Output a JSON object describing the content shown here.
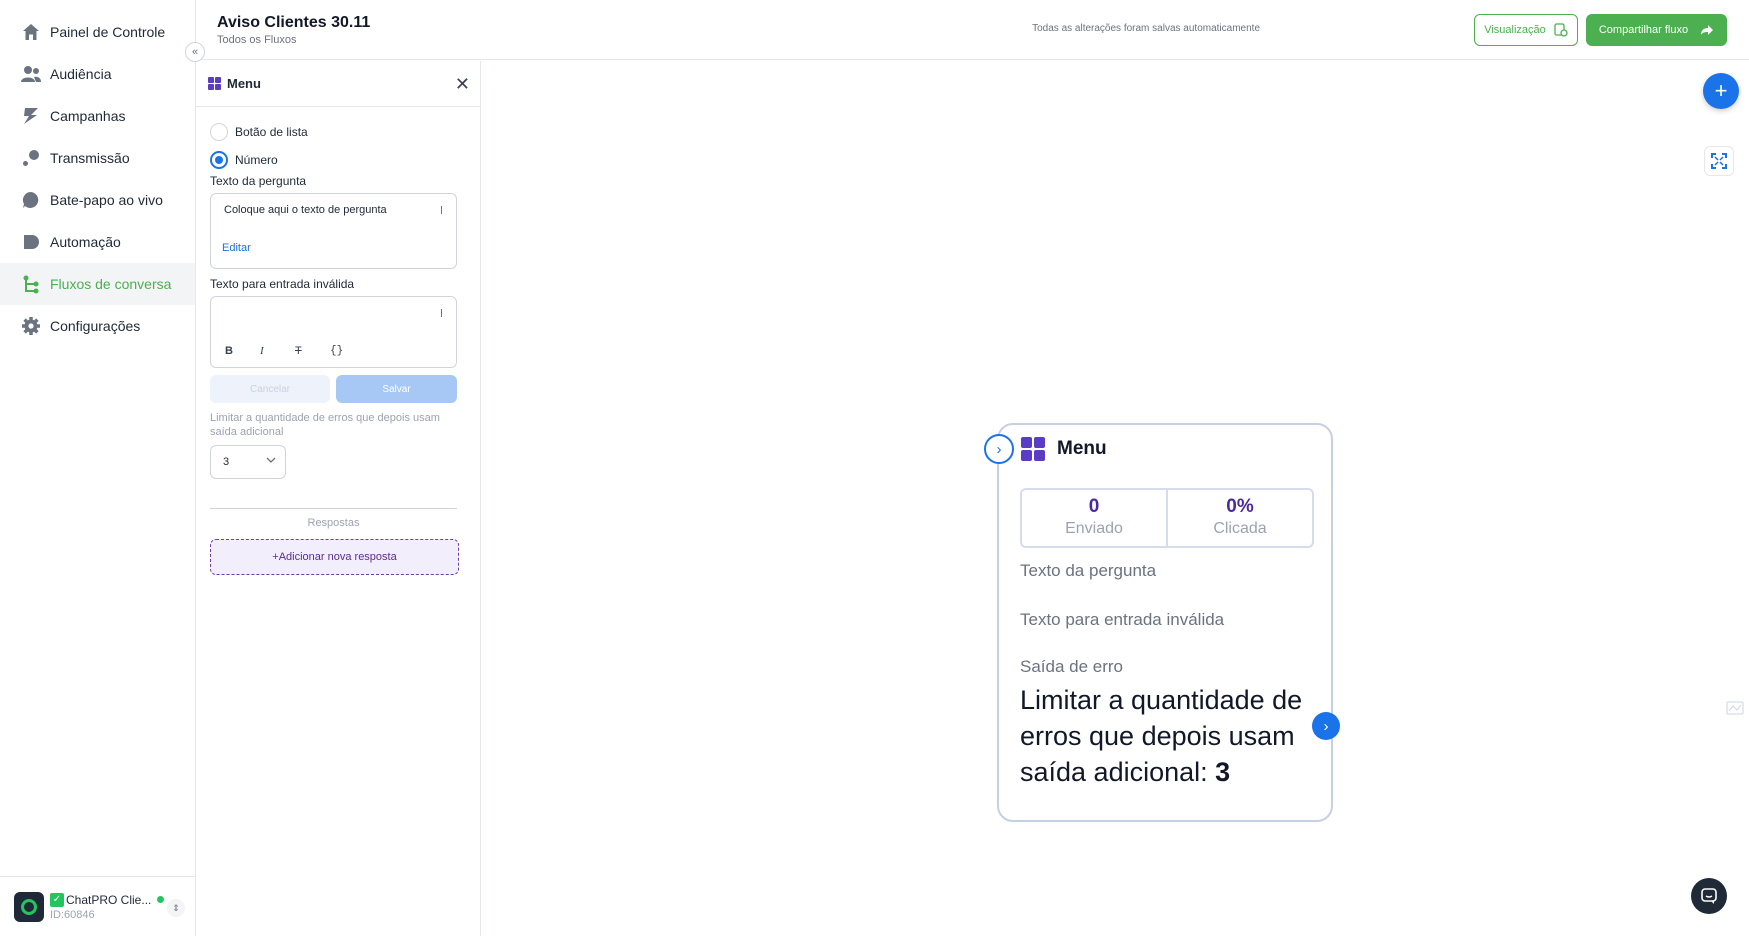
{
  "sidebar": {
    "items": [
      {
        "label": "Painel de Controle",
        "icon": "home-icon"
      },
      {
        "label": "Audiência",
        "icon": "users-icon"
      },
      {
        "label": "Campanhas",
        "icon": "campaign-icon"
      },
      {
        "label": "Transmissão",
        "icon": "broadcast-icon"
      },
      {
        "label": "Bate-papo ao vivo",
        "icon": "chat-icon"
      },
      {
        "label": "Automação",
        "icon": "automation-icon"
      },
      {
        "label": "Fluxos de conversa",
        "icon": "flow-icon"
      },
      {
        "label": "Configurações",
        "icon": "gear-icon"
      }
    ],
    "collapse_glyph": "«",
    "account": {
      "name": "ChatPRO Clie...",
      "id": "ID:60846"
    }
  },
  "header": {
    "title": "Aviso Clientes 30.11",
    "breadcrumb": "Todos os Fluxos",
    "autosave": "Todas as alterações foram salvas automaticamente",
    "preview_label": "Visualização",
    "share_label": "Compartilhar fluxo"
  },
  "panel": {
    "title": "Menu",
    "radio_list": "Botão de lista",
    "radio_number": "Número",
    "question_label": "Texto da pergunta",
    "question_text": "Coloque aqui o texto de pergunta",
    "edit_label": "Editar",
    "invalid_label": "Texto para entrada inválida",
    "cancel_label": "Cancelar",
    "save_label": "Salvar",
    "limit_text": "Limitar a quantidade de erros que depois usam saída adicional",
    "limit_value": "3",
    "responses_title": "Respostas",
    "add_response": "+Adicionar nova resposta"
  },
  "node": {
    "title": "Menu",
    "sent_value": "0",
    "sent_label": "Enviado",
    "clicked_value": "0%",
    "clicked_label": "Clicada",
    "question_label": "Texto da pergunta",
    "invalid_label": "Texto para entrada inválida",
    "error_label": "Saída de erro",
    "error_text": "Limitar a quantidade de erros que depois usam saída adicional:",
    "error_value": "3"
  },
  "colors": {
    "brand_green": "#4caf50",
    "accent_blue": "#1a73e8",
    "purple": "#5b3cc4"
  }
}
